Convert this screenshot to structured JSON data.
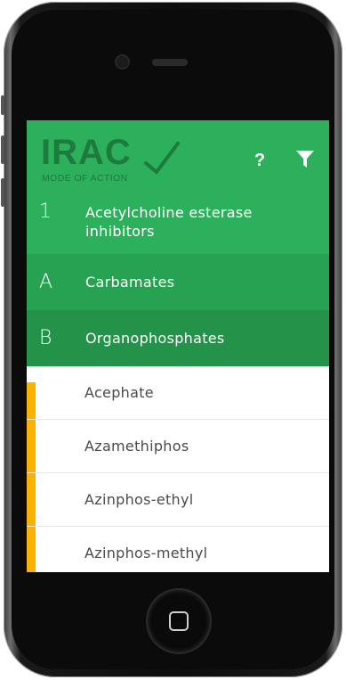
{
  "app": {
    "logo_text": "IRAC",
    "logo_subtitle": "MODE OF ACTION",
    "help_label": "?",
    "brand_color": "#2cb05b",
    "accent_color": "#f9b200"
  },
  "header": {
    "icons": [
      "help-icon",
      "filter-icon"
    ]
  },
  "breadcrumb": {
    "group": {
      "code": "1",
      "label": "Acetylcholine esterase inhibitors"
    },
    "subgroup_a": {
      "code": "A",
      "label": "Carbamates"
    },
    "subgroup_b": {
      "code": "B",
      "label": "Organophosphates"
    }
  },
  "list": {
    "items": [
      {
        "label": "Acephate"
      },
      {
        "label": "Azamethiphos"
      },
      {
        "label": "Azinphos-ethyl"
      },
      {
        "label": "Azinphos-methyl"
      }
    ]
  }
}
